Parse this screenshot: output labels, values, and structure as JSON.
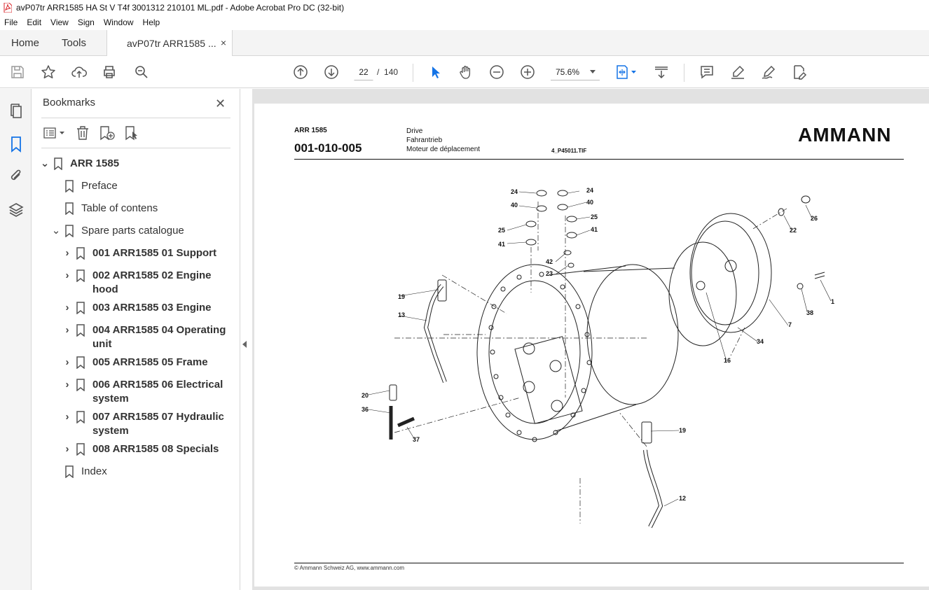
{
  "window": {
    "title": "avP07tr ARR1585 HA St V T4f 3001312 210101 ML.pdf - Adobe Acrobat Pro DC (32-bit)"
  },
  "menu": [
    "File",
    "Edit",
    "View",
    "Sign",
    "Window",
    "Help"
  ],
  "tabs": {
    "home": "Home",
    "tools": "Tools",
    "document": "avP07tr ARR1585 ...",
    "close": "×"
  },
  "toolbar": {
    "current_page": "22",
    "page_separator": "/",
    "total_pages": "140",
    "zoom": "75.6%"
  },
  "bookmarks": {
    "title": "Bookmarks",
    "close": "✕",
    "items": [
      {
        "label": "ARR 1585"
      },
      {
        "label": "Preface"
      },
      {
        "label": "Table of contens"
      },
      {
        "label": "Spare parts catalogue"
      },
      {
        "label": "001 ARR1585 01 Support"
      },
      {
        "label": "002 ARR1585 02 Engine hood"
      },
      {
        "label": "003 ARR1585 03 Engine"
      },
      {
        "label": "004 ARR1585 04 Operating unit"
      },
      {
        "label": "005 ARR1585 05 Frame"
      },
      {
        "label": "006 ARR1585 06 Electrical system"
      },
      {
        "label": "007 ARR1585 07 Hydraulic system"
      },
      {
        "label": "008 ARR1585 08 Specials"
      },
      {
        "label": "Index"
      }
    ]
  },
  "page": {
    "model": "ARR 1585",
    "code": "001-010-005",
    "title_en": "Drive",
    "title_de": "Fahrantrieb",
    "title_fr": "Moteur de déplacement",
    "image_file": "4_P45011.TIF",
    "logo": "AMMANN",
    "footer": "© Ammann Schweiz AG, www.ammann.com",
    "callouts": [
      "24",
      "40",
      "24",
      "40",
      "25",
      "41",
      "25",
      "41",
      "42",
      "23",
      "26",
      "22",
      "1",
      "38",
      "7",
      "34",
      "16",
      "19",
      "13",
      "20",
      "36",
      "37",
      "19",
      "12"
    ]
  },
  "colors": {
    "accent_blue": "#1473e6",
    "chrome_bg": "#f4f4f4",
    "doc_bg": "#e2e2e2",
    "pdf_red": "#d9262b"
  }
}
